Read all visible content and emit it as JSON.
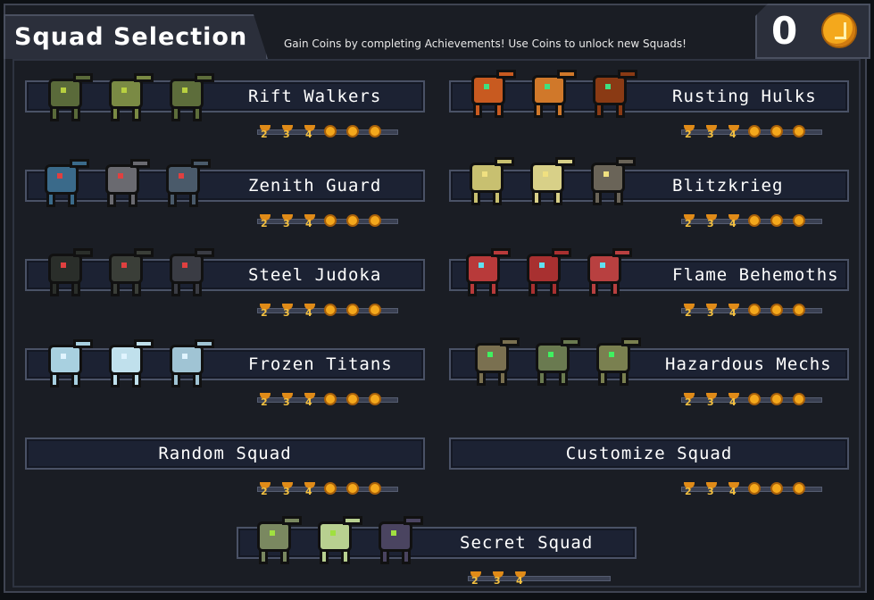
{
  "header": {
    "title": "Squad Selection",
    "hint": "Gain Coins by completing Achievements! Use Coins to unlock new Squads!",
    "coin_count": "0"
  },
  "colors": {
    "coin": "#f4a81c",
    "trophy": "#e08b18",
    "panel": "#1c2233",
    "border": "#4a5266"
  },
  "squads": [
    {
      "name": "Rift Walkers",
      "mech_colors": [
        "#5a6a3a",
        "#7a8a44",
        "#5d6d3b"
      ],
      "eye": "#b8d040",
      "trophies": [
        "2",
        "3",
        "4"
      ],
      "coins": 3
    },
    {
      "name": "Rusting Hulks",
      "mech_colors": [
        "#c85a20",
        "#d0782a",
        "#8a3a14"
      ],
      "eye": "#40e080",
      "trophies": [
        "2",
        "3",
        "4"
      ],
      "coins": 3
    },
    {
      "name": "Zenith Guard",
      "mech_colors": [
        "#3a6a8a",
        "#6a6a70",
        "#4a5a6a"
      ],
      "eye": "#e04040",
      "trophies": [
        "2",
        "3",
        "4"
      ],
      "coins": 3
    },
    {
      "name": "Blitzkrieg",
      "mech_colors": [
        "#c8c070",
        "#d8d088",
        "#6a6458"
      ],
      "eye": "#f0e080",
      "trophies": [
        "2",
        "3",
        "4"
      ],
      "coins": 3
    },
    {
      "name": "Steel Judoka",
      "mech_colors": [
        "#2a2e2a",
        "#3a3e38",
        "#3a3c44"
      ],
      "eye": "#e04040",
      "trophies": [
        "2",
        "3",
        "4"
      ],
      "coins": 3
    },
    {
      "name": "Flame Behemoths",
      "mech_colors": [
        "#b83a3a",
        "#a83030",
        "#b84040"
      ],
      "eye": "#60e0f0",
      "trophies": [
        "2",
        "3",
        "4"
      ],
      "coins": 3
    },
    {
      "name": "Frozen Titans",
      "mech_colors": [
        "#a8d0e0",
        "#c0e0ec",
        "#a0c4d4"
      ],
      "eye": "#e0f4ff",
      "trophies": [
        "2",
        "3",
        "4"
      ],
      "coins": 3
    },
    {
      "name": "Hazardous Mechs",
      "mech_colors": [
        "#7a7050",
        "#6a7a50",
        "#7a8050"
      ],
      "eye": "#40f060",
      "trophies": [
        "2",
        "3",
        "4"
      ],
      "coins": 3
    },
    {
      "name": "Random Squad",
      "mech_colors": [],
      "eye": "",
      "trophies": [
        "2",
        "3",
        "4"
      ],
      "coins": 3
    },
    {
      "name": "Customize Squad",
      "mech_colors": [],
      "eye": "",
      "trophies": [
        "2",
        "3",
        "4"
      ],
      "coins": 3
    },
    {
      "name": "Secret Squad",
      "mech_colors": [
        "#7a8860",
        "#b8d090",
        "#4a4460"
      ],
      "eye": "#a0e040",
      "trophies": [
        "2",
        "3",
        "4"
      ],
      "coins": 0
    }
  ]
}
